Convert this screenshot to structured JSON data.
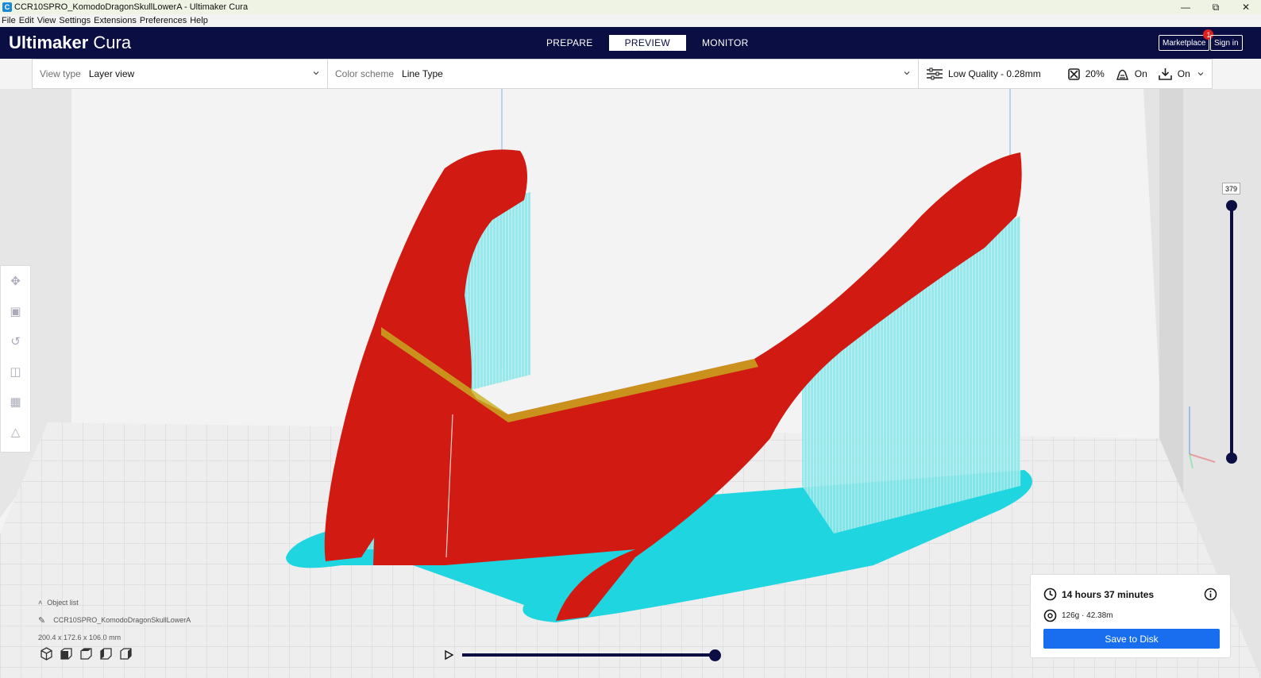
{
  "window": {
    "title": "CCR10SPRO_KomodoDragonSkullLowerA - Ultimaker Cura",
    "app_icon_letter": "C",
    "controls": [
      "minimize",
      "restore",
      "close"
    ]
  },
  "menu": {
    "items": [
      "File",
      "Edit",
      "View",
      "Settings",
      "Extensions",
      "Preferences",
      "Help"
    ]
  },
  "header": {
    "logo_bold": "Ultimaker",
    "logo_light": " Cura",
    "stages": [
      {
        "label": "PREPARE",
        "active": false
      },
      {
        "label": "PREVIEW",
        "active": true
      },
      {
        "label": "MONITOR",
        "active": false
      }
    ],
    "marketplace_label": "Marketplace",
    "marketplace_badge": "1",
    "signin_label": "Sign in"
  },
  "toolbar": {
    "view_type_label": "View type",
    "view_type_value": "Layer view",
    "color_scheme_label": "Color scheme",
    "color_scheme_value": "Line Type",
    "profile": "Low Quality - 0.28mm",
    "infill": "20%",
    "support": "On",
    "adhesion": "On"
  },
  "layer_slider": {
    "current_layer": "379"
  },
  "object_list": {
    "label": "Object list",
    "object_name": "CCR10SPRO_KomodoDragonSkullLowerA",
    "dimensions": "200.4 x 172.6 x 106.0 mm"
  },
  "print_info": {
    "time": "14 hours 37 minutes",
    "material": "126g · 42.38m",
    "save_label": "Save to Disk"
  },
  "colors": {
    "header_bg": "#0a0e43",
    "accent_blue": "#196ef0",
    "wall_red": "#d01a12",
    "support_cyan": "#7fe3e6",
    "skirt_cyan": "#1fd6e0",
    "badge_red": "#e02020"
  }
}
